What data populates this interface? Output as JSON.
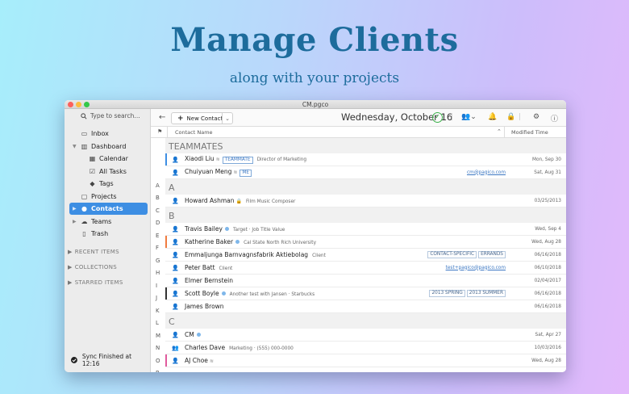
{
  "hero": {
    "title": "Manage Clients",
    "subtitle": "along with your projects"
  },
  "window": {
    "title": "CM.pgco"
  },
  "sidebar": {
    "search_placeholder": "Type to search...",
    "items": [
      {
        "label": "Inbox",
        "icon": "inbox-icon"
      },
      {
        "label": "Dashboard",
        "icon": "dashboard-icon"
      },
      {
        "label": "Calendar",
        "icon": "calendar-icon"
      },
      {
        "label": "All Tasks",
        "icon": "tasks-icon"
      },
      {
        "label": "Tags",
        "icon": "tags-icon"
      },
      {
        "label": "Projects",
        "icon": "projects-icon"
      },
      {
        "label": "Contacts",
        "icon": "contacts-icon",
        "selected": true
      },
      {
        "label": "Teams",
        "icon": "teams-icon"
      },
      {
        "label": "Trash",
        "icon": "trash-icon"
      }
    ],
    "sections": [
      "RECENT ITEMS",
      "COLLECTIONS",
      "STARRED ITEMS"
    ],
    "sync": "Sync Finished at 12:16"
  },
  "toolbar": {
    "new_contact": "New Contact",
    "date": "Wednesday, October 16"
  },
  "columns": {
    "name": "Contact Name",
    "modified": "Modified Time"
  },
  "alphabet": [
    "A",
    "B",
    "C",
    "D",
    "E",
    "F",
    "G",
    "H",
    "I",
    "J",
    "K",
    "L",
    "M",
    "N",
    "O",
    "P",
    "R"
  ],
  "groups": {
    "teammates": "TEAMMATES",
    "a": "A",
    "b": "B",
    "c": "C"
  },
  "rows": [
    {
      "name": "Xiaodi Liu",
      "badge": "TEAMMATE",
      "sub": "Director of Marketing",
      "date": "Mon, Sep 30",
      "bar": "#3d8ee3"
    },
    {
      "name": "Chuiyuan Meng",
      "badge": "ME",
      "email": "cm@pagico.com",
      "date": "Sat, Aug 31"
    },
    {
      "name": "Howard Ashman",
      "sub": "Film Music Composer",
      "date": "03/25/2013"
    },
    {
      "name": "Travis Bailey",
      "sub": "Target · Job Title Value",
      "date": "Wed, Sep 4"
    },
    {
      "name": "Katherine Baker",
      "sub": "Cal State North Rich University",
      "date": "Wed, Aug 28",
      "bar": "#f07b3f"
    },
    {
      "name": "Emmaljunga Barnvagnsfabrik Aktiebolag",
      "sub": "Client",
      "tags": [
        "CONTACT-SPECIFIC",
        "ERRANDS"
      ],
      "date": "06/16/2018"
    },
    {
      "name": "Peter Batt",
      "sub": "Client",
      "email": "test+pagico@pagico.com",
      "date": "06/10/2018"
    },
    {
      "name": "Elmer Bernstein",
      "date": "02/04/2017"
    },
    {
      "name": "Scott Boyle",
      "sub": "Another test with Jansen · Starbucks",
      "tags": [
        "2013 SPRING",
        "2013 SUMMER"
      ],
      "date": "06/16/2018",
      "bar": "#333333"
    },
    {
      "name": "James Brown",
      "date": "06/16/2018"
    },
    {
      "name": "CM",
      "date": "Sat, Apr 27"
    },
    {
      "name": "Charles Dave",
      "sub": "Marketing · (555) 000-0000",
      "date": "10/03/2016"
    },
    {
      "name": "AJ Choe",
      "date": "Wed, Aug 28",
      "bar": "#e05a9d"
    }
  ]
}
